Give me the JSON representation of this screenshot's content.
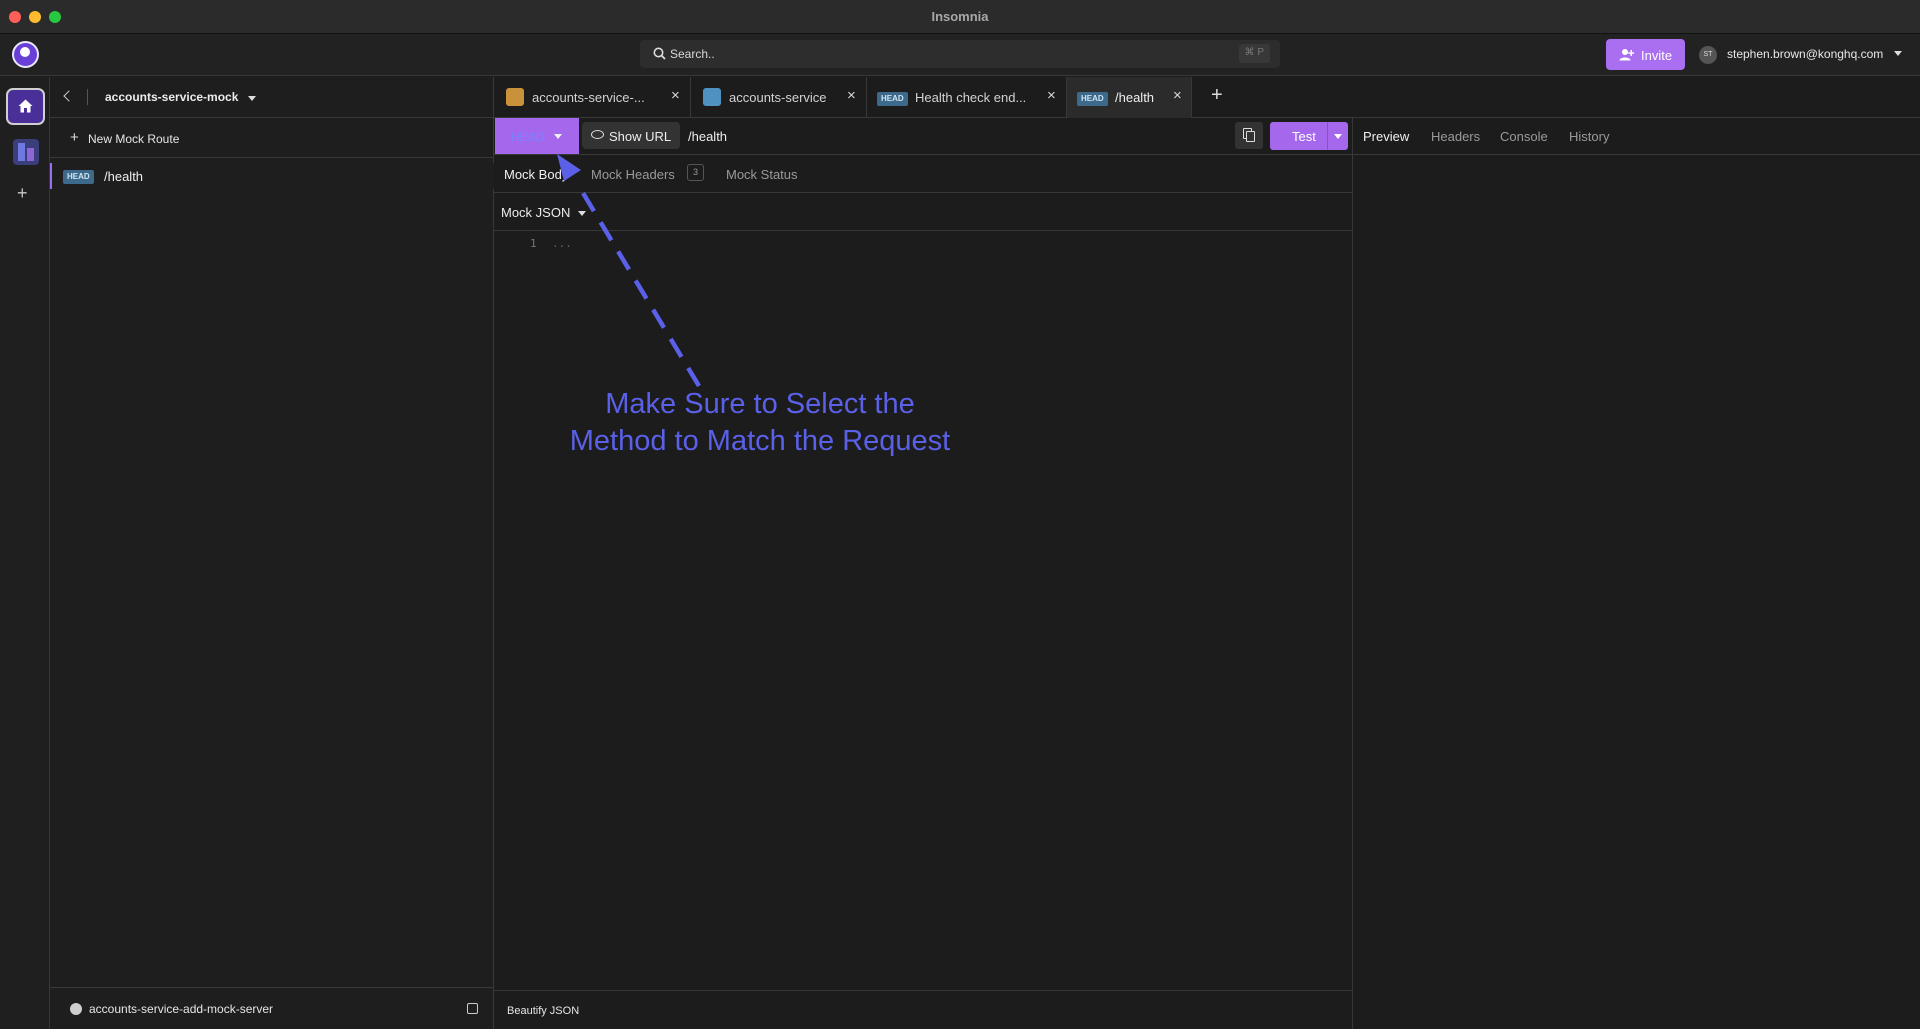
{
  "window": {
    "title": "Insomnia"
  },
  "topbar": {
    "search_placeholder": "Search..",
    "search_shortcut": "⌘ P",
    "invite_label": "Invite",
    "user_initials": "ST",
    "user_email": "stephen.brown@konghq.com"
  },
  "sidebar": {
    "project_title": "accounts-service-mock",
    "new_route_label": "New Mock Route",
    "items": [
      {
        "method": "HEAD",
        "path": "/health"
      }
    ],
    "footer_branch": "accounts-service-add-mock-server"
  },
  "tabs": [
    {
      "label": "accounts-service-...",
      "icon": "mock-server-icon",
      "icon_color": "#c9913a"
    },
    {
      "label": "accounts-service",
      "icon": "document-icon",
      "icon_color": "#4f92c2"
    },
    {
      "method": "HEAD",
      "label": "Health check end..."
    },
    {
      "method": "HEAD",
      "label": "/health",
      "active": true
    }
  ],
  "request": {
    "method": "HEAD",
    "show_url_label": "Show URL",
    "url": "/health",
    "test_label": "Test"
  },
  "subtabs": {
    "body": "Mock Body",
    "headers": "Mock Headers",
    "headers_count": "3",
    "status": "Mock Status"
  },
  "body": {
    "format": "Mock JSON",
    "line_number": "1",
    "code": "...",
    "footer_action": "Beautify JSON"
  },
  "response_tabs": [
    "Preview",
    "Headers",
    "Console",
    "History"
  ],
  "annotation": {
    "line1": "Make Sure to Select the",
    "line2": "Method to Match the Request",
    "color": "#5a60e8"
  },
  "colors": {
    "accent": "#a568ec",
    "head_badge": "#3d6a8a"
  }
}
